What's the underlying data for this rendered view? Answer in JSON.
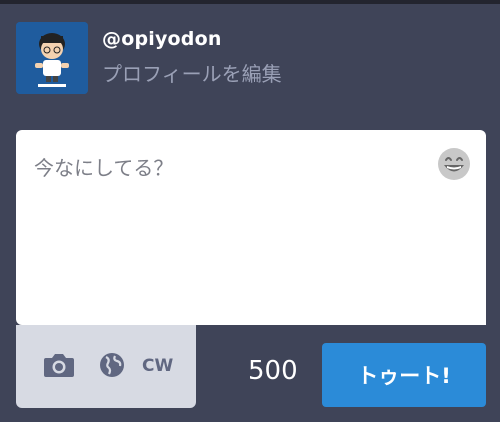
{
  "account": {
    "handle": "@opiyodon",
    "edit_profile_label": "プロフィールを編集",
    "avatar_icon": "user-avatar"
  },
  "compose": {
    "placeholder": "今なにしてる？",
    "value": "",
    "emoji_icon": "grinning-face-icon"
  },
  "toolbar": {
    "camera_icon": "camera-icon",
    "privacy_icon": "globe-icon",
    "cw_label": "CW"
  },
  "footer": {
    "char_count": "500",
    "submit_label": "トゥート!"
  },
  "colors": {
    "background": "#3f4458",
    "accent": "#2b8bd8",
    "toolbar_bg": "#d7dae3",
    "icon": "#606781"
  }
}
